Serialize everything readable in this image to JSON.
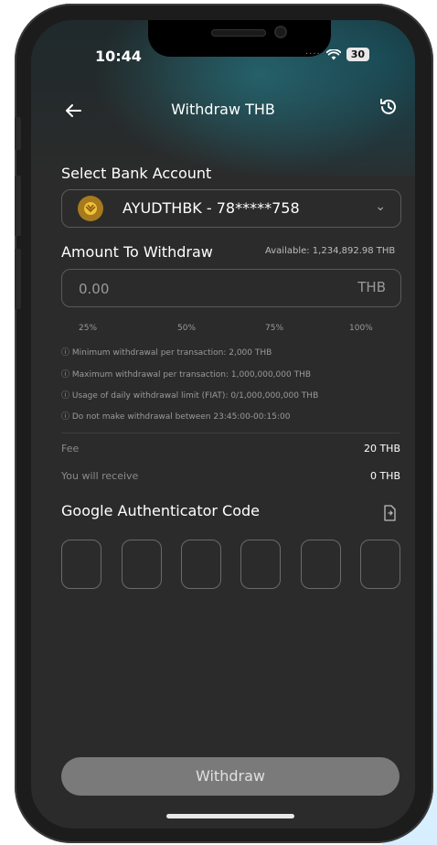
{
  "status_bar": {
    "time": "10:44",
    "battery": "30"
  },
  "nav": {
    "back_icon": "arrow-left-icon",
    "title": "Withdraw THB",
    "history_icon": "history-icon"
  },
  "bank": {
    "section_label": "Select Bank Account",
    "selected": "AYUDTHBK - 78*****758",
    "logo_icon": "bank-logo-icon",
    "chevron_icon": "chevron-down-icon"
  },
  "amount": {
    "section_label": "Amount To Withdraw",
    "available": "Available: 1,234,892.98 THB",
    "placeholder": "0.00",
    "unit": "THB",
    "percent_options": [
      "25%",
      "50%",
      "75%",
      "100%"
    ]
  },
  "notes": [
    "ⓘ Minimum withdrawal per transaction: 2,000 THB",
    "ⓘ Maximum withdrawal per transaction: 1,000,000,000 THB",
    "ⓘ Usage of daily withdrawal limit (FIAT): 0/1,000,000,000 THB",
    "ⓘ Do not make withdrawal between 23:45:00-00:15:00"
  ],
  "summary": {
    "fee_label": "Fee",
    "fee_value": "20 THB",
    "receive_label": "You will receive",
    "receive_value": "0 THB"
  },
  "authenticator": {
    "label": "Google Authenticator Code",
    "paste_icon": "paste-icon",
    "digits": 6
  },
  "submit": {
    "label": "Withdraw"
  },
  "colors": {
    "background": "#2b2b2b",
    "button": "#7a7a7a",
    "border": "#5a5a5a",
    "bank_logo": "#a67a1d"
  }
}
